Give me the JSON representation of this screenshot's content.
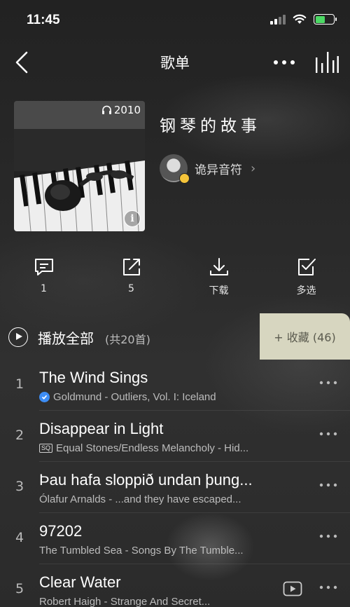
{
  "status_bar": {
    "time": "11:45"
  },
  "nav": {
    "title": "歌单"
  },
  "playlist": {
    "play_count": "2010",
    "title": "钢琴的故事",
    "creator": "诡异音符"
  },
  "actions": [
    {
      "id": "comment",
      "label": "1",
      "icon": "comment-icon"
    },
    {
      "id": "share",
      "label": "5",
      "icon": "share-icon"
    },
    {
      "id": "download",
      "label": "下载",
      "icon": "download-icon"
    },
    {
      "id": "multiselect",
      "label": "多选",
      "icon": "checkbox-icon"
    }
  ],
  "list_header": {
    "play_all_label": "播放全部",
    "song_count_label": "(共20首)",
    "collect_label": "+ 收藏 (46)"
  },
  "songs": [
    {
      "index": "1",
      "title": "The Wind Sings",
      "subtitle": "Goldmund - Outliers, Vol. I: Iceland",
      "badge": "verified"
    },
    {
      "index": "2",
      "title": "Disappear in Light",
      "subtitle": "Equal Stones/Endless Melancholy - Hid...",
      "badge": "SQ"
    },
    {
      "index": "3",
      "title": "Þau hafa sloppið undan þung...",
      "subtitle": "Ólafur Arnalds - ...and they have escaped...",
      "badge": ""
    },
    {
      "index": "4",
      "title": "97202",
      "subtitle": "The Tumbled Sea - Songs By The Tumble...",
      "badge": ""
    },
    {
      "index": "5",
      "title": "Clear Water",
      "subtitle": "Robert Haigh - Strange And Secret...",
      "badge": "mv"
    }
  ],
  "colors": {
    "collect_bg": "#d7d6c0",
    "verified": "#3d8df5",
    "battery": "#4cd964"
  }
}
